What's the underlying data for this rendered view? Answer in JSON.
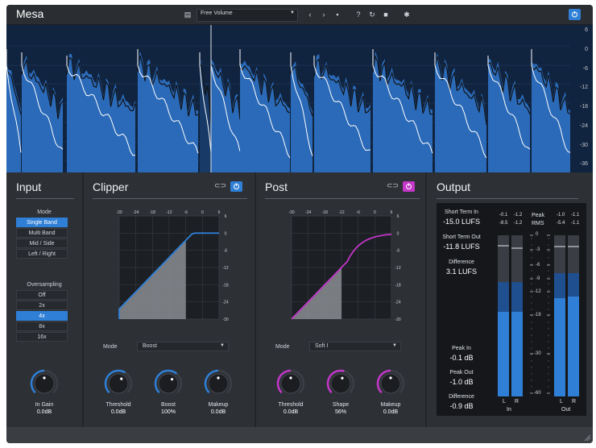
{
  "app": {
    "title": "Mesa"
  },
  "toolbar": {
    "preset": "Free Volume"
  },
  "waveform": {
    "db_scale": [
      "6",
      "0",
      "-6",
      "-12",
      "-18",
      "-24",
      "-30",
      "-36"
    ]
  },
  "input": {
    "title": "Input",
    "mode_label": "Mode",
    "modes": [
      "Single Band",
      "Multi Band",
      "Mid / Side",
      "Left / Right"
    ],
    "mode_selected": 0,
    "oversampling_label": "Oversampling",
    "oversampling": [
      "Off",
      "2x",
      "4x",
      "8x",
      "16x"
    ],
    "oversampling_selected": 2,
    "gain": {
      "label": "In Gain",
      "value": "0.0dB",
      "level": 0.5
    }
  },
  "clipper": {
    "title": "Clipper",
    "x_ticks": [
      "-30",
      "-24",
      "-18",
      "-12",
      "-6",
      "0",
      "6"
    ],
    "y_ticks": [
      "6",
      "0",
      "-6",
      "-12",
      "-18",
      "-24",
      "-30"
    ],
    "mode_label": "Mode",
    "mode_value": "Boost",
    "knobs": [
      {
        "label": "Threshold",
        "value": "0.0dB",
        "level": 0.62
      },
      {
        "label": "Boost",
        "value": "100%",
        "level": 0.65
      },
      {
        "label": "Makeup",
        "value": "0.0dB",
        "level": 0.5
      }
    ]
  },
  "post": {
    "title": "Post",
    "x_ticks": [
      "-30",
      "-24",
      "-18",
      "-12",
      "-6",
      "0",
      "6"
    ],
    "y_ticks": [
      "6",
      "0",
      "-6",
      "-12",
      "-18",
      "-24",
      "-30"
    ],
    "mode_label": "Mode",
    "mode_value": "Soft I",
    "knobs": [
      {
        "label": "Threshold",
        "value": "0.0dB",
        "level": 0.5
      },
      {
        "label": "Shape",
        "value": "56%",
        "level": 0.56
      },
      {
        "label": "Makeup",
        "value": "0.0dB",
        "level": 0.5
      }
    ]
  },
  "output": {
    "title": "Output",
    "short_term_in_label": "Short Term In",
    "short_term_in_value": "-15.0 LUFS",
    "short_term_out_label": "Short Term Out",
    "short_term_out_value": "-11.8 LUFS",
    "difference_label": "Difference",
    "difference_value": "3.1 LUFS",
    "peak_in_label": "Peak In",
    "peak_in_value": "-0.1 dB",
    "peak_out_label": "Peak Out",
    "peak_out_value": "-1.0 dB",
    "peak_diff_label": "Difference",
    "peak_diff_value": "-0.9 dB",
    "peak_label": "Peak",
    "rms_label": "RMS",
    "in_peak": [
      "-0.1",
      "-1.2"
    ],
    "in_rms": [
      "-8.5",
      "-1.2"
    ],
    "out_peak": [
      "-1.0",
      "-1.1"
    ],
    "out_rms": [
      "-5.4",
      "-1.1"
    ],
    "scale": [
      "0",
      "-3",
      "-6",
      "-9",
      "-12",
      "-18",
      "-30",
      "-60"
    ],
    "channel_left": "L",
    "channel_right": "R",
    "in_label": "In",
    "out_label": "Out"
  },
  "colors": {
    "accent": "#2f7fd6",
    "post_accent": "#c236c8",
    "wave": "#2b6ab8"
  }
}
